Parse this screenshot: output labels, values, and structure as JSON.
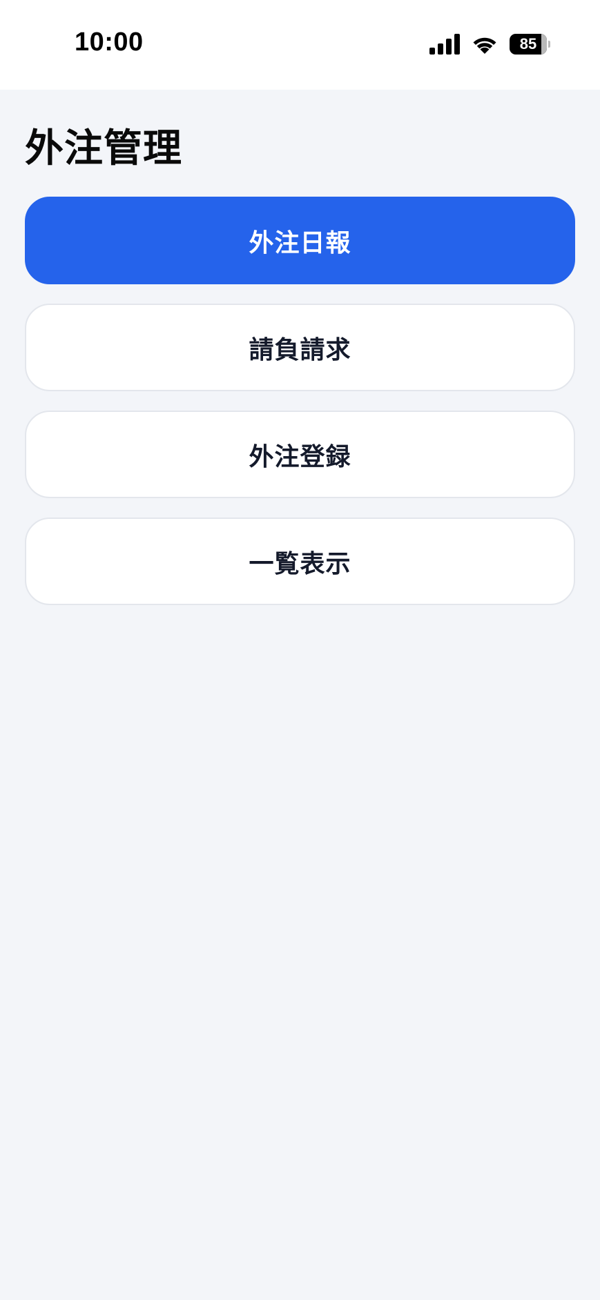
{
  "status_bar": {
    "time": "10:00",
    "battery_level": "85",
    "icons": [
      "signal-icon",
      "wifi-icon",
      "battery-icon"
    ]
  },
  "page": {
    "title": "外注管理"
  },
  "menu": {
    "items": [
      {
        "label": "外注日報",
        "primary": true
      },
      {
        "label": "請負請求",
        "primary": false
      },
      {
        "label": "外注登録",
        "primary": false
      },
      {
        "label": "一覧表示",
        "primary": false
      }
    ]
  },
  "colors": {
    "accent": "#2563eb",
    "background": "#f3f5f9",
    "card": "#ffffff",
    "text": "#141a2b"
  }
}
